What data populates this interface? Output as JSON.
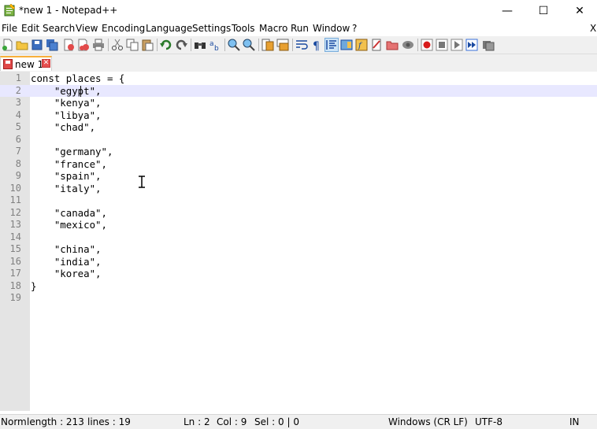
{
  "window": {
    "title": "*new 1 - Notepad++",
    "minimize_glyph": "—",
    "maximize_glyph": "☐",
    "close_glyph": "✕"
  },
  "menu": {
    "items": [
      "File",
      "Edit",
      "Search",
      "View",
      "Encoding",
      "Language",
      "Settings",
      "Tools",
      "Macro",
      "Run",
      "Window",
      "?"
    ],
    "close_label": "X"
  },
  "toolbar": {
    "icons": [
      "new-file-icon",
      "open-file-icon",
      "save-icon",
      "save-all-icon",
      "close-icon",
      "close-all-icon",
      "print-icon",
      "cut-icon",
      "copy-icon",
      "paste-icon",
      "undo-icon",
      "redo-icon",
      "find-icon",
      "replace-icon",
      "zoom-in-icon",
      "zoom-out-icon",
      "sync-vertical-icon",
      "sync-horizontal-icon",
      "word-wrap-icon",
      "show-all-characters-icon",
      "indent-guide-icon",
      "doc-map-icon",
      "function-list-icon",
      "folder-as-workspace-icon",
      "monitoring-icon",
      "record-macro-icon",
      "stop-macro-icon",
      "play-macro-icon",
      "run-macro-multiple-icon",
      "save-macro-icon"
    ]
  },
  "tab": {
    "label": "new 1",
    "close_glyph": "✕"
  },
  "editor": {
    "active_line": 2,
    "lines": [
      "const places = {",
      "    \"egypt\",",
      "    \"kenya\",",
      "    \"libya\",",
      "    \"chad\",",
      "",
      "    \"germany\",",
      "    \"france\",",
      "    \"spain\",",
      "    \"italy\",",
      "",
      "    \"canada\",",
      "    \"mexico\",",
      "",
      "    \"china\",",
      "    \"india\",",
      "    \"korea\",",
      "}",
      ""
    ]
  },
  "status": {
    "doc_type": "Norm",
    "length": "length : 213",
    "lines": "lines : 19",
    "line": "Ln : 2",
    "col": "Col : 9",
    "sel": "Sel : 0 | 0",
    "eol": "Windows (CR LF)",
    "encoding": "UTF-8",
    "mode": "IN"
  }
}
